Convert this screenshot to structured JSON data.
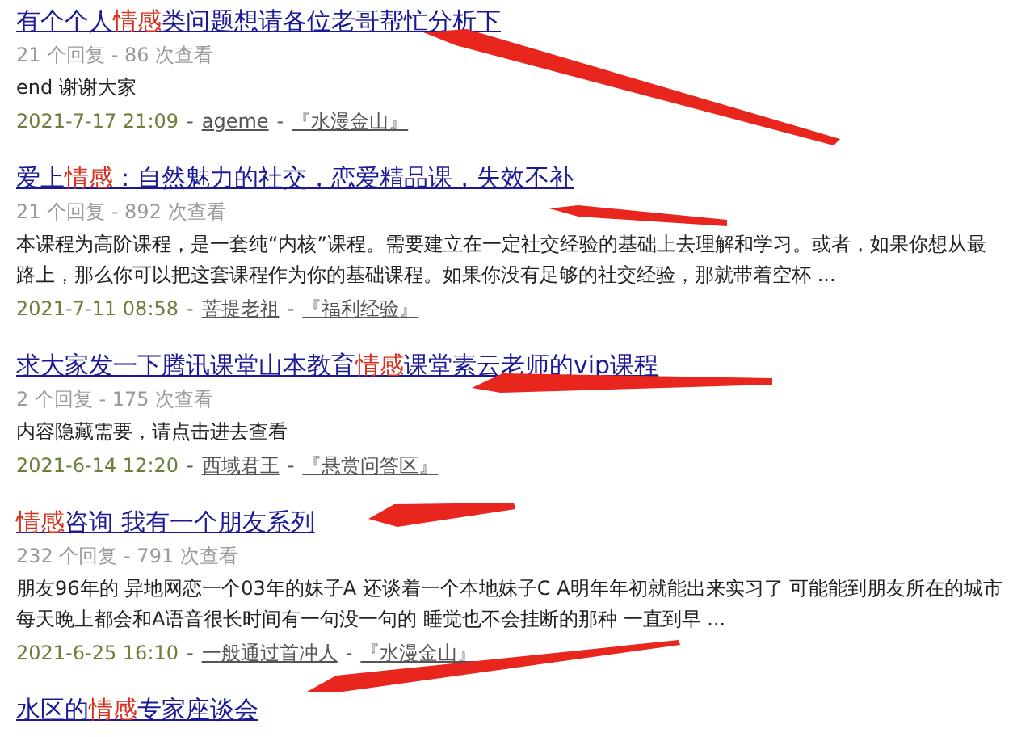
{
  "results": [
    {
      "title": [
        {
          "text": "有个个人",
          "highlight": false
        },
        {
          "text": "情感",
          "highlight": true
        },
        {
          "text": "类问题想请各位老哥帮忙分析下",
          "highlight": false
        }
      ],
      "stats": "21 个回复 - 86 次查看",
      "excerpt": [
        "end 谢谢大家"
      ],
      "footer": [
        {
          "kind": "date",
          "text": "2021-7-17 21:09"
        },
        {
          "kind": "separator",
          "text": "-"
        },
        {
          "kind": "link",
          "text": "ageme"
        },
        {
          "kind": "separator",
          "text": "-"
        },
        {
          "kind": "link",
          "text": "『水漫金山』"
        }
      ]
    },
    {
      "title": [
        {
          "text": "爱上",
          "highlight": false
        },
        {
          "text": "情感",
          "highlight": true
        },
        {
          "text": "：自然魅力的社交，恋爱精品课，失效不补",
          "highlight": false
        }
      ],
      "stats": "21 个回复 - 892 次查看",
      "excerpt": [
        "本课程为高阶课程，是一套纯“内核”课程。需要建立在一定社交经验的基础上去理解和学习。或者，如果你想从最",
        "路上，那么你可以把这套课程作为你的基础课程。如果你没有足够的社交经验，那就带着空杯 ..."
      ],
      "footer": [
        {
          "kind": "date",
          "text": "2021-7-11 08:58"
        },
        {
          "kind": "separator",
          "text": "-"
        },
        {
          "kind": "link",
          "text": "菩提老祖"
        },
        {
          "kind": "separator",
          "text": "-"
        },
        {
          "kind": "link",
          "text": "『福利经验』"
        }
      ]
    },
    {
      "title": [
        {
          "text": "求大家发一下腾讯课堂山本教育",
          "highlight": false
        },
        {
          "text": "情感",
          "highlight": true
        },
        {
          "text": "课堂素云老师的vip课程",
          "highlight": false
        }
      ],
      "stats": "2 个回复 - 175 次查看",
      "excerpt": [
        "内容隐藏需要，请点击进去查看"
      ],
      "footer": [
        {
          "kind": "date",
          "text": "2021-6-14 12:20"
        },
        {
          "kind": "separator",
          "text": "-"
        },
        {
          "kind": "link",
          "text": "西域君王"
        },
        {
          "kind": "separator",
          "text": "-"
        },
        {
          "kind": "link",
          "text": "『悬赏问答区』"
        }
      ]
    },
    {
      "title": [
        {
          "text": "情感",
          "highlight": true
        },
        {
          "text": "咨询 我有一个朋友系列",
          "highlight": false
        }
      ],
      "stats": "232 个回复 - 791 次查看",
      "excerpt": [
        "朋友96年的 异地网恋一个03年的妹子A 还谈着一个本地妹子C A明年年初就能出来实习了 可能能到朋友所在的城市",
        "每天晚上都会和A语音很长时间有一句没一句的 睡觉也不会挂断的那种 一直到早 ..."
      ],
      "footer": [
        {
          "kind": "date",
          "text": "2021-6-25 16:10"
        },
        {
          "kind": "separator",
          "text": "-"
        },
        {
          "kind": "link",
          "text": "一般通过首冲人"
        },
        {
          "kind": "separator",
          "text": "-"
        },
        {
          "kind": "link",
          "text": "『水漫金山』"
        }
      ]
    },
    {
      "title": [
        {
          "text": "水区的",
          "highlight": false
        },
        {
          "text": "情感",
          "highlight": true
        },
        {
          "text": "专家座谈会",
          "highlight": false
        }
      ]
    }
  ]
}
